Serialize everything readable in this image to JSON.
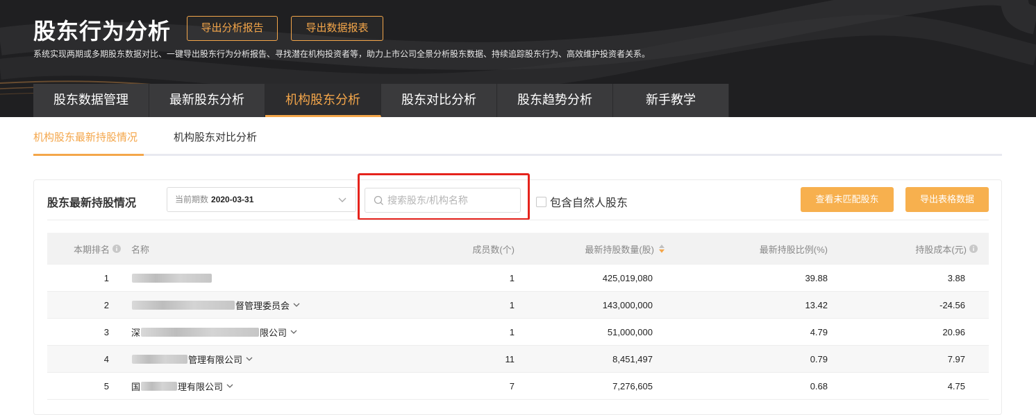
{
  "header": {
    "title": "股东行为分析",
    "export_report_label": "导出分析报告",
    "export_data_label": "导出数据报表",
    "description": "系统实现两期或多期股东数据对比、一键导出股东行为分析报告、寻找潜在机构投资者等，助力上市公司全景分析股东数据、持续追踪股东行为、高效维护投资者关系。"
  },
  "main_tabs": [
    {
      "label": "股东数据管理"
    },
    {
      "label": "最新股东分析"
    },
    {
      "label": "机构股东分析"
    },
    {
      "label": "股东对比分析"
    },
    {
      "label": "股东趋势分析"
    },
    {
      "label": "新手教学"
    }
  ],
  "sub_tabs": [
    {
      "label": "机构股东最新持股情况"
    },
    {
      "label": "机构股东对比分析"
    }
  ],
  "panel": {
    "title": "股东最新持股情况",
    "period_prefix": "当前期数",
    "period_value": "2020-03-31",
    "search_placeholder": "搜索股东/机构名称",
    "checkbox_label": "包含自然人股东",
    "unmatched_button": "查看未匹配股东",
    "export_table_button": "导出表格数据"
  },
  "table": {
    "headers": {
      "rank": "本期排名",
      "name": "名称",
      "members": "成员数(个)",
      "qty": "最新持股数量(股)",
      "ratio": "最新持股比例(%)",
      "cost": "持股成本(元)"
    },
    "rows": [
      {
        "rank": "1",
        "name_visible": "",
        "members": "1",
        "qty": "425,019,080",
        "ratio": "39.88",
        "cost": "3.88"
      },
      {
        "rank": "2",
        "name_visible": "督管理委员会",
        "members": "1",
        "qty": "143,000,000",
        "ratio": "13.42",
        "cost": "-24.56"
      },
      {
        "rank": "3",
        "name_visible": "深",
        "name_suffix": "限公司",
        "members": "1",
        "qty": "51,000,000",
        "ratio": "4.79",
        "cost": "20.96"
      },
      {
        "rank": "4",
        "name_visible": "管理有限公司",
        "members": "11",
        "qty": "8,451,497",
        "ratio": "0.79",
        "cost": "7.97"
      },
      {
        "rank": "5",
        "name_visible": "国",
        "name_suffix": "理有限公司",
        "members": "7",
        "qty": "7,276,605",
        "ratio": "0.68",
        "cost": "4.75"
      }
    ]
  },
  "colors": {
    "accent": "#f4a64a",
    "button_fill": "#f7b04e",
    "highlight": "#e5231c",
    "hero_bg": "#1f1f21"
  }
}
